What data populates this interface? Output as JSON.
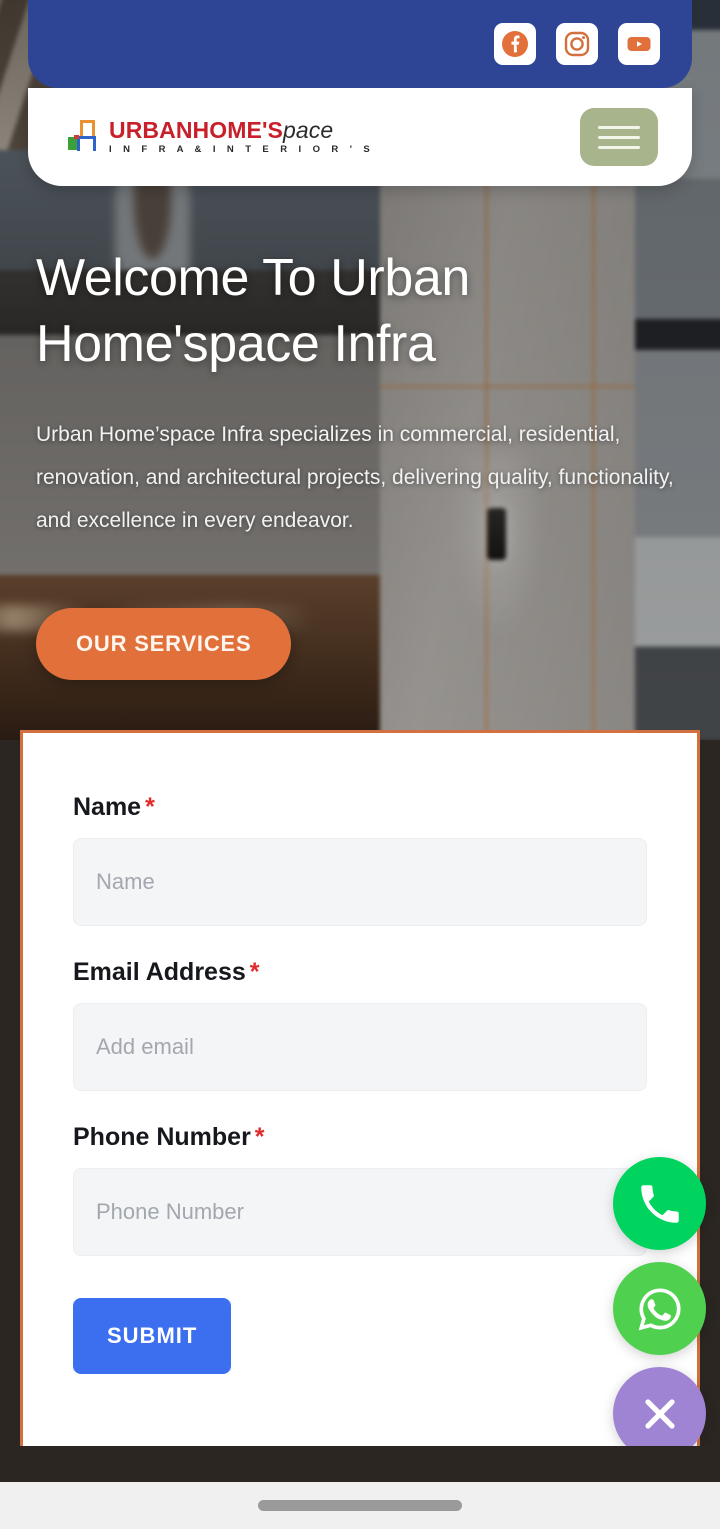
{
  "topbar": {
    "background_color": "#2e4596",
    "social_links": [
      {
        "name": "facebook",
        "label": "Facebook",
        "color": "#e2703a"
      },
      {
        "name": "instagram",
        "label": "Instagram",
        "color": "#d2713f"
      },
      {
        "name": "youtube",
        "label": "YouTube",
        "color": "#e2703a"
      }
    ]
  },
  "header": {
    "logo": {
      "word_primary": "URBANHOME'S",
      "word_secondary": "pace",
      "tagline": "I N F R A   &   I N T E R I O R ' S",
      "primary_color": "#c8202b",
      "secondary_color": "#2b2b2b"
    },
    "menu_button_label": "Menu",
    "menu_button_color": "#a8b48b"
  },
  "hero": {
    "title": "Welcome To Urban Home'space Infra",
    "subtitle": "Urban Home’space Infra specializes in commercial, residential, renovation, and architectural projects, delivering quality, functionality, and excellence in every endeavor.",
    "cta_label": "OUR SERVICES",
    "cta_color": "#e2703a"
  },
  "form": {
    "border_color": "#d2713f",
    "required_marker": "*",
    "fields": [
      {
        "name": "name",
        "label": "Name",
        "placeholder": "Name",
        "value": "",
        "required": true
      },
      {
        "name": "email",
        "label": "Email Address",
        "placeholder": "Add email",
        "value": "",
        "required": true
      },
      {
        "name": "phone",
        "label": "Phone Number",
        "placeholder": "Phone Number",
        "value": "",
        "required": true
      }
    ],
    "submit_label": "SUBMIT",
    "submit_color": "#3c6ff0"
  },
  "floating_actions": [
    {
      "name": "call",
      "icon": "phone-icon",
      "label": "Call",
      "color": "#00d45e"
    },
    {
      "name": "whatsapp",
      "icon": "whatsapp-icon",
      "label": "WhatsApp",
      "color": "#4fd14f"
    },
    {
      "name": "close",
      "icon": "close-icon",
      "label": "Close",
      "color": "#a084d4"
    }
  ]
}
